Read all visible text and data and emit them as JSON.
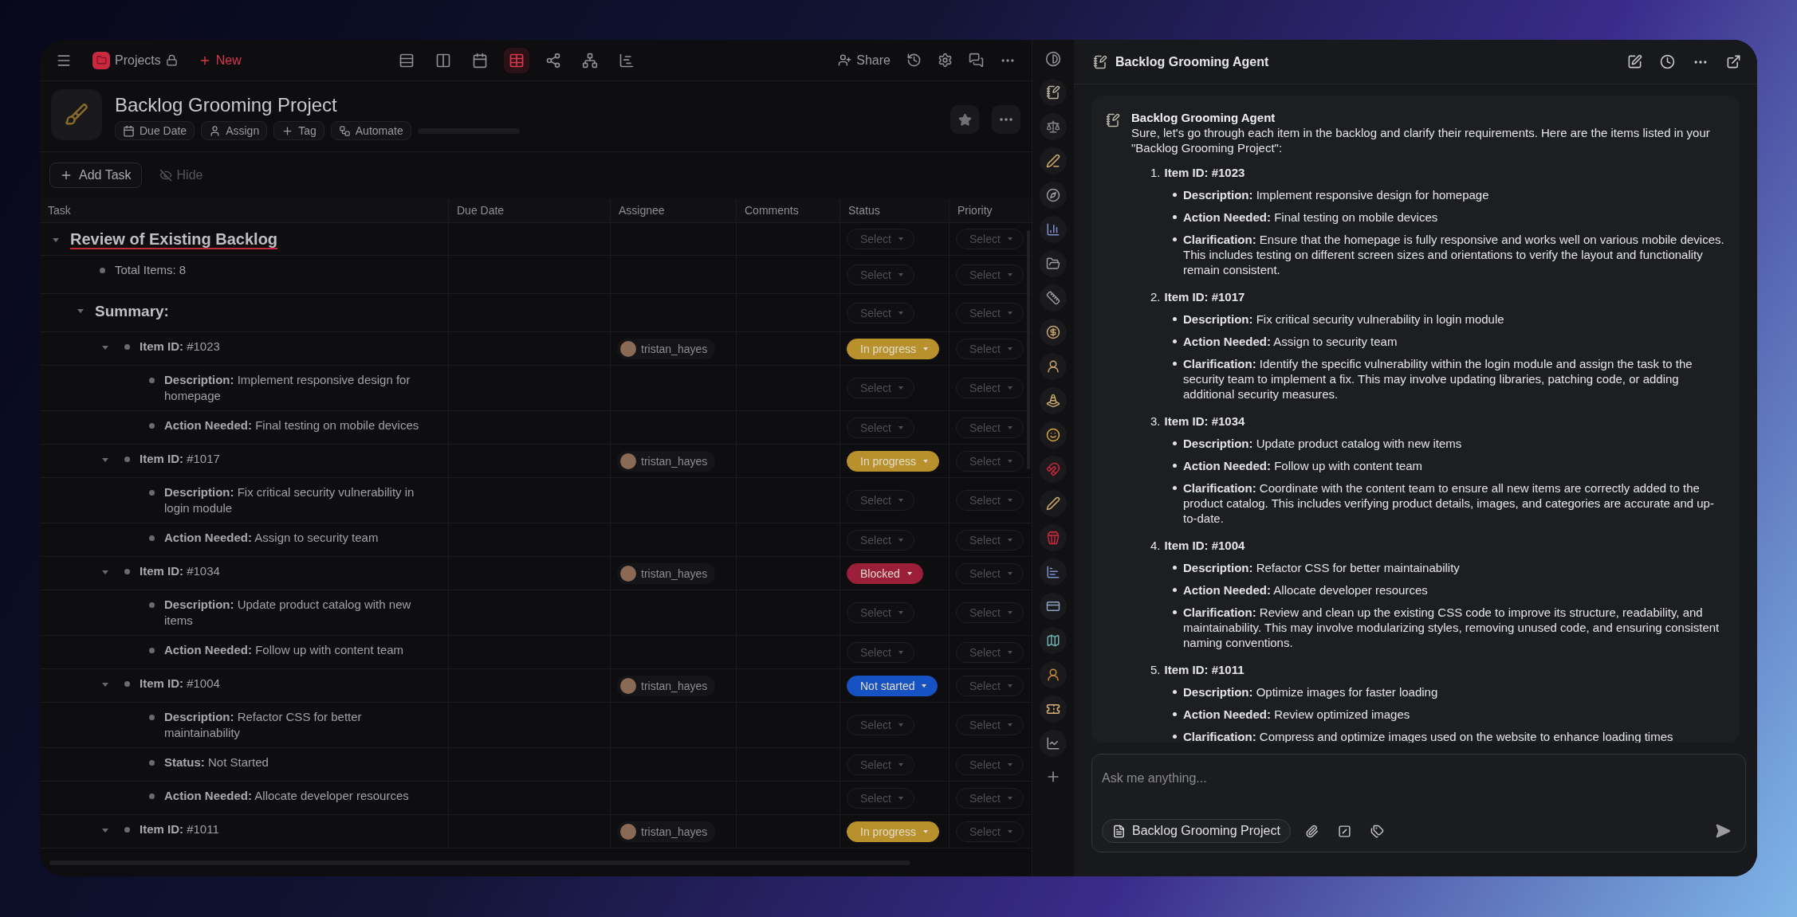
{
  "topbar": {
    "projects_label": "Projects",
    "new_label": "New",
    "share_label": "Share",
    "views": [
      {
        "selected": false
      },
      {
        "selected": false
      },
      {
        "selected": false
      },
      {
        "selected": true
      },
      {
        "selected": false
      },
      {
        "selected": false
      },
      {
        "selected": false
      }
    ]
  },
  "project": {
    "title": "Backlog Grooming Project",
    "chips": [
      "Due Date",
      "Assign",
      "Tag",
      "Automate"
    ],
    "progress": {
      "level": 0
    }
  },
  "toolbar": {
    "add_task": "Add Task",
    "hide": "Hide"
  },
  "table": {
    "columns": [
      "Task",
      "Due Date",
      "Assignee",
      "Comments",
      "Status",
      "Priority"
    ],
    "rows": [
      {
        "kind": "heading",
        "text": "Review of Existing Backlog",
        "expanded": true,
        "status": {
          "label": "Select"
        },
        "priority": "Select",
        "children": [
          {
            "kind": "bullet",
            "text": "Total Items: 8",
            "status": {
              "label": "Select"
            },
            "priority": "Select"
          },
          {
            "kind": "subheading",
            "text": "Summary:",
            "expanded": true,
            "status": {
              "label": "Select"
            },
            "priority": "Select",
            "children": [
              {
                "kind": "bullet",
                "text": "**Item ID:** #1023",
                "expanded": true,
                "assignee": "tristan_hayes",
                "status": {
                  "label": "In progress",
                  "color": "#b8912c"
                },
                "priority": "Select",
                "children": [
                  {
                    "kind": "bullet",
                    "text": "**Description:** Implement responsive design for homepage",
                    "status": {
                      "label": "Select"
                    },
                    "priority": "Select"
                  },
                  {
                    "kind": "bullet",
                    "text": "**Action Needed:** Final testing on mobile devices",
                    "status": {
                      "label": "Select"
                    },
                    "priority": "Select"
                  }
                ]
              },
              {
                "kind": "bullet",
                "text": "**Item ID:** #1017",
                "expanded": true,
                "assignee": "tristan_hayes",
                "status": {
                  "label": "In progress",
                  "color": "#b8912c"
                },
                "priority": "Select",
                "children": [
                  {
                    "kind": "bullet",
                    "text": "**Description:** Fix critical security vulnerability in login module",
                    "status": {
                      "label": "Select"
                    },
                    "priority": "Select"
                  },
                  {
                    "kind": "bullet",
                    "text": "**Action Needed:** Assign to security team",
                    "status": {
                      "label": "Select"
                    },
                    "priority": "Select"
                  }
                ]
              },
              {
                "kind": "bullet",
                "text": "**Item ID:** #1034",
                "expanded": true,
                "assignee": "tristan_hayes",
                "status": {
                  "label": "Blocked",
                  "color": "#9c1f3a"
                },
                "priority": "Select",
                "children": [
                  {
                    "kind": "bullet",
                    "text": "**Description:** Update product catalog with new items",
                    "status": {
                      "label": "Select"
                    },
                    "priority": "Select"
                  },
                  {
                    "kind": "bullet",
                    "text": "**Action Needed:** Follow up with content team",
                    "status": {
                      "label": "Select"
                    },
                    "priority": "Select"
                  }
                ]
              },
              {
                "kind": "bullet",
                "text": "**Item ID:** #1004",
                "expanded": true,
                "assignee": "tristan_hayes",
                "status": {
                  "label": "Not started",
                  "color": "#1752c2"
                },
                "priority": "Select",
                "children": [
                  {
                    "kind": "bullet",
                    "text": "**Description:** Refactor CSS for better maintainability",
                    "status": {
                      "label": "Select"
                    },
                    "priority": "Select"
                  },
                  {
                    "kind": "bullet",
                    "text": "**Status:** Not Started",
                    "status": {
                      "label": "Select"
                    },
                    "priority": "Select"
                  },
                  {
                    "kind": "bullet",
                    "text": "**Action Needed:** Allocate developer resources",
                    "status": {
                      "label": "Select"
                    },
                    "priority": "Select"
                  }
                ]
              },
              {
                "kind": "bullet",
                "text": "**Item ID:** #1011",
                "expanded": true,
                "assignee": "tristan_hayes",
                "status": {
                  "label": "In progress",
                  "color": "#b8912c"
                },
                "priority": "Select"
              }
            ]
          }
        ]
      }
    ]
  },
  "chat": {
    "title": "Backlog Grooming Agent",
    "message": {
      "author": "Backlog Grooming Agent",
      "intro": "Sure, let's go through each item in the backlog and clarify their requirements. Here are the items listed in your \"Backlog Grooming Project\":",
      "items": [
        {
          "number": "1.",
          "title": "Item ID: #1023",
          "points": [
            "**Description:** Implement responsive design for homepage",
            "**Action Needed:** Final testing on mobile devices",
            "**Clarification:** Ensure that the homepage is fully responsive and works well on various mobile devices. This includes testing on different screen sizes and orientations to verify the layout and functionality remain consistent."
          ]
        },
        {
          "number": "2.",
          "title": "Item ID: #1017",
          "points": [
            "**Description:** Fix critical security vulnerability in login module",
            "**Action Needed:** Assign to security team",
            "**Clarification:** Identify the specific vulnerability within the login module and assign the task to the security team to implement a fix. This may involve updating libraries, patching code, or adding additional security measures."
          ]
        },
        {
          "number": "3.",
          "title": "Item ID: #1034",
          "points": [
            "**Description:** Update product catalog with new items",
            "**Action Needed:** Follow up with content team",
            "**Clarification:** Coordinate with the content team to ensure all new items are correctly added to the product catalog. This includes verifying product details, images, and categories are accurate and up-to-date."
          ]
        },
        {
          "number": "4.",
          "title": "Item ID: #1004",
          "points": [
            "**Description:** Refactor CSS for better maintainability",
            "**Action Needed:** Allocate developer resources",
            "**Clarification:** Review and clean up the existing CSS code to improve its structure, readability, and maintainability. This may involve modularizing styles, removing unused code, and ensuring consistent naming conventions."
          ]
        },
        {
          "number": "5.",
          "title": "Item ID: #1011",
          "points": [
            "**Description:** Optimize images for faster loading",
            "**Action Needed:** Review optimized images",
            "**Clarification:** Compress and optimize images used on the website to enhance loading times"
          ]
        }
      ]
    },
    "input": {
      "placeholder": "Ask me anything...",
      "context_chip": "Backlog Grooming Project"
    }
  }
}
